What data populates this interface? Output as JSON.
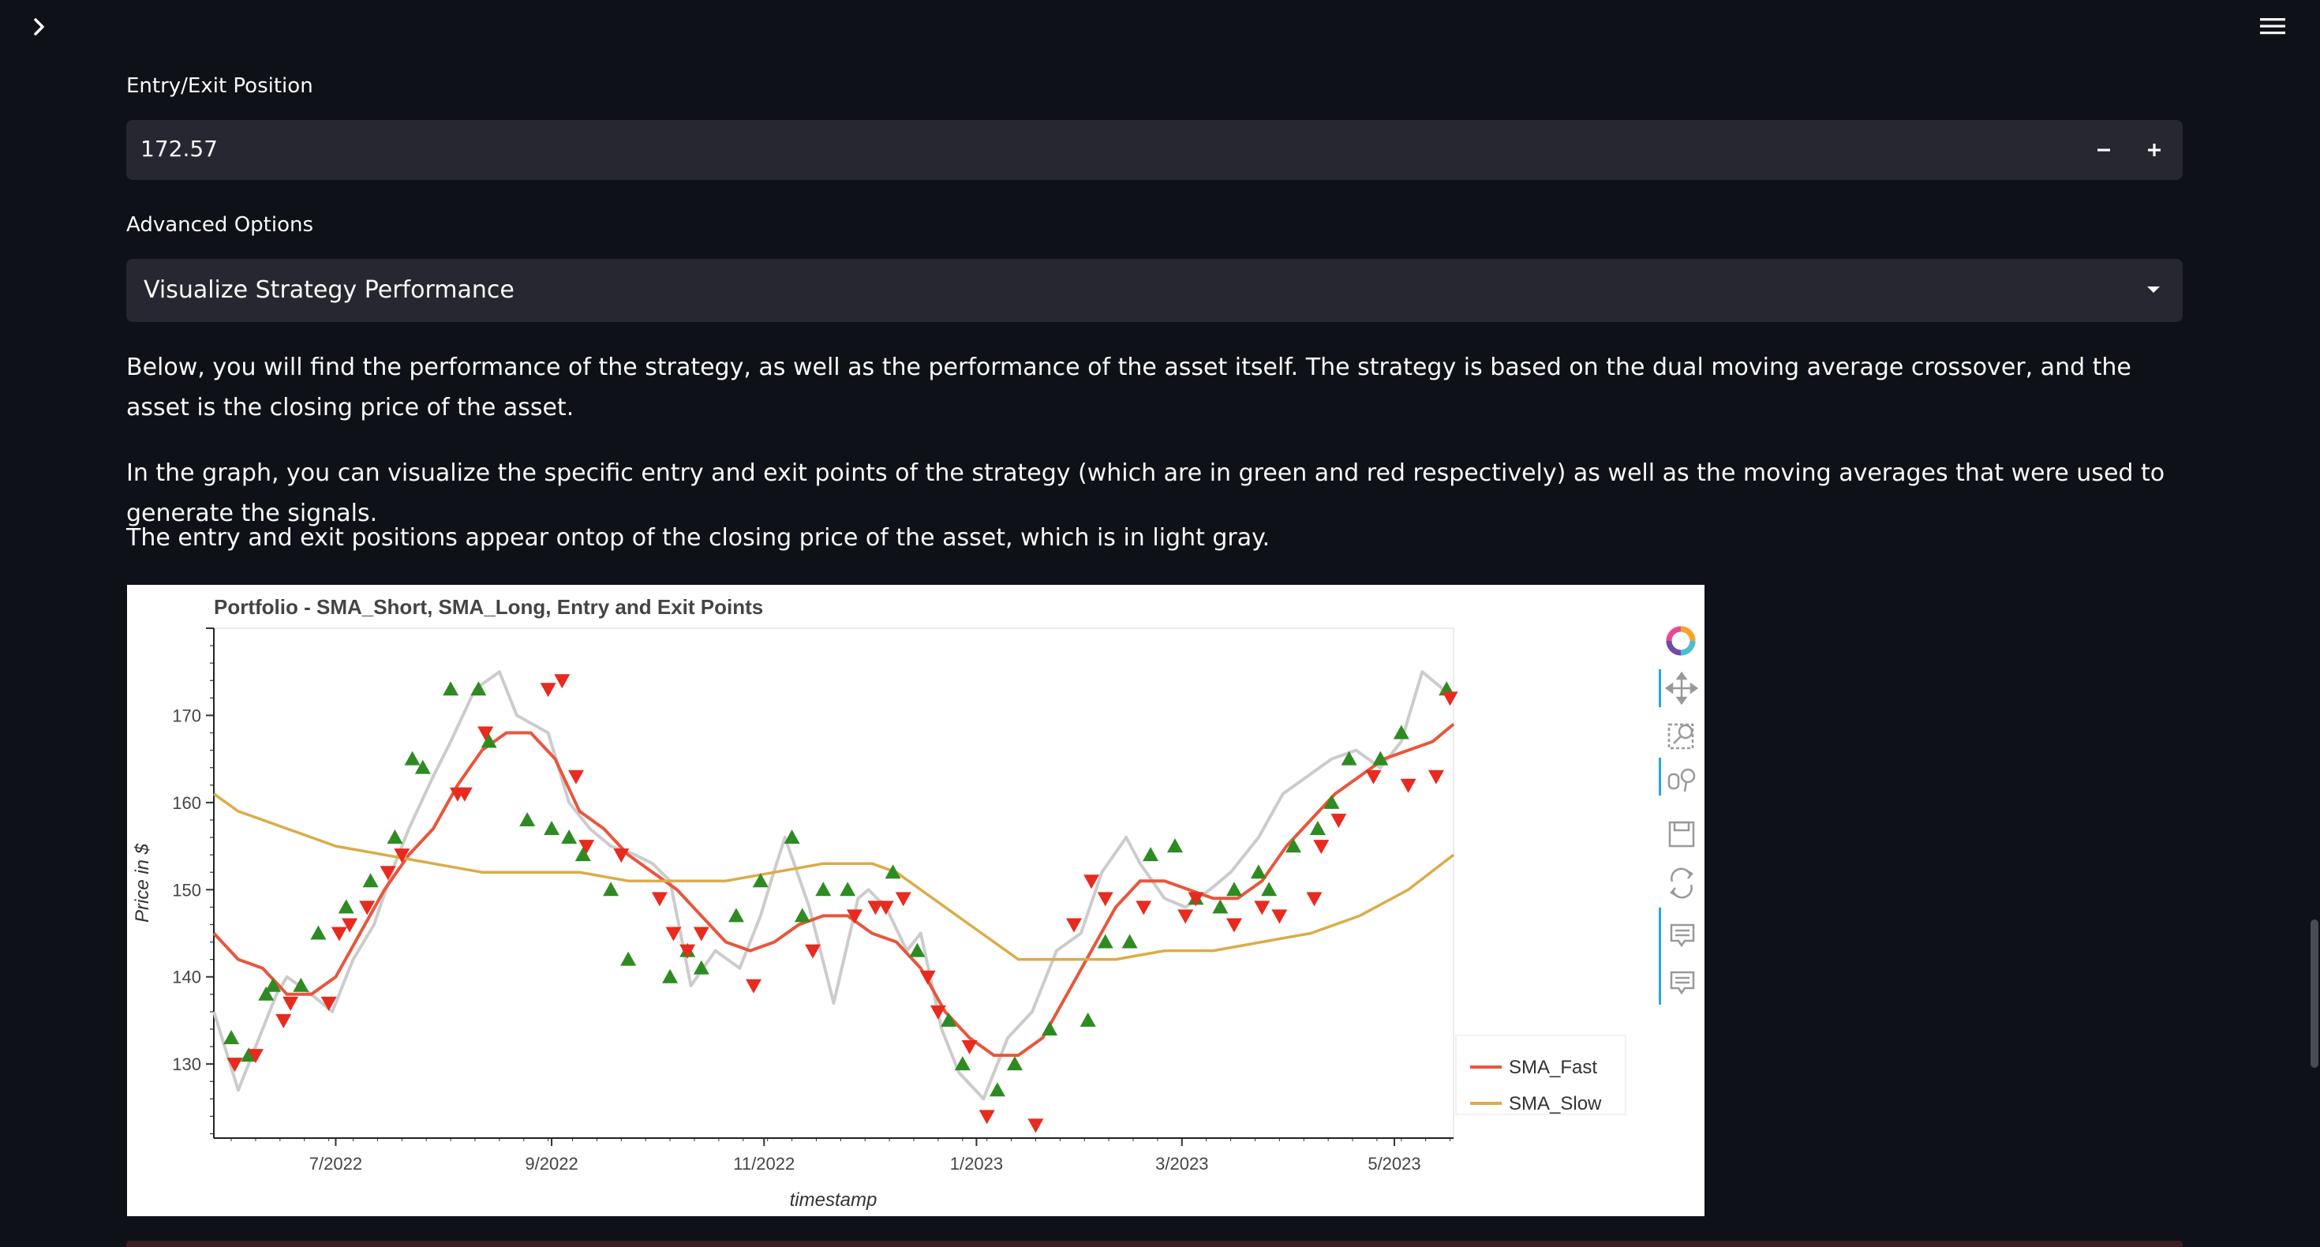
{
  "entry_exit": {
    "label": "Entry/Exit Position",
    "value": "172.57",
    "decrement_icon": "minus-icon",
    "increment_icon": "plus-icon"
  },
  "advanced": {
    "label": "Advanced Options",
    "selected": "Visualize Strategy Performance"
  },
  "paragraphs": {
    "p1": "Below, you will find the performance of the strategy, as well as the performance of the asset itself. The strategy is based on the dual moving average crossover, and the asset is the closing price of the asset.",
    "p2": "In the graph, you can visualize the specific entry and exit points of the strategy (which are in green and red respectively) as well as the moving averages that were used to generate the signals.",
    "p3": "The entry and exit positions appear ontop of the closing price of the asset, which is in light gray."
  },
  "toolbar_icons": [
    "bokeh-logo-icon",
    "pan-icon",
    "box-zoom-icon",
    "wheel-zoom-icon",
    "save-icon",
    "reset-icon",
    "hover-icon",
    "hover-icon-2"
  ],
  "chart_data": {
    "type": "line",
    "title": "Portfolio - SMA_Short, SMA_Long, Entry and Exit Points",
    "xlabel": "timestamp",
    "ylabel": "Price in $",
    "x_ticks": [
      "7/2022",
      "9/2022",
      "11/2022",
      "1/2023",
      "3/2023",
      "5/2023"
    ],
    "x_range": [
      "2022-05-27",
      "2023-05-18"
    ],
    "ylim": [
      121.5,
      180
    ],
    "y_ticks": [
      130,
      140,
      150,
      160,
      170
    ],
    "legend_position": "bottom-right",
    "colors": {
      "close": "#cccccc",
      "fast": "#e8563b",
      "slow": "#dcab48",
      "entry": "#2e8b22",
      "exit": "#e82a1f"
    },
    "series": [
      {
        "name": "Close",
        "x": [
          "2022-05-27",
          "2022-06-03",
          "2022-06-07",
          "2022-06-14",
          "2022-06-17",
          "2022-06-24",
          "2022-06-30",
          "2022-07-06",
          "2022-07-12",
          "2022-07-18",
          "2022-07-22",
          "2022-07-29",
          "2022-08-03",
          "2022-08-10",
          "2022-08-17",
          "2022-08-22",
          "2022-08-31",
          "2022-09-06",
          "2022-09-12",
          "2022-09-18",
          "2022-09-25",
          "2022-09-30",
          "2022-10-05",
          "2022-10-11",
          "2022-10-18",
          "2022-10-25",
          "2022-10-31",
          "2022-11-03",
          "2022-11-07",
          "2022-11-14",
          "2022-11-21",
          "2022-11-28",
          "2022-12-01",
          "2022-12-06",
          "2022-12-12",
          "2022-12-16",
          "2022-12-22",
          "2022-12-27",
          "2023-01-03",
          "2023-01-10",
          "2023-01-17",
          "2023-01-24",
          "2023-01-31",
          "2023-02-06",
          "2023-02-13",
          "2023-02-17",
          "2023-02-24",
          "2023-03-02",
          "2023-03-09",
          "2023-03-15",
          "2023-03-23",
          "2023-03-30",
          "2023-04-06",
          "2023-04-13",
          "2023-04-20",
          "2023-04-27",
          "2023-05-03",
          "2023-05-09",
          "2023-05-15"
        ],
        "values": [
          136,
          127,
          131,
          138,
          140,
          138,
          136,
          142,
          146,
          153,
          157,
          163,
          167,
          173,
          175,
          170,
          168,
          160,
          157,
          155,
          154,
          153,
          151,
          139,
          143,
          141,
          147,
          151,
          156,
          148,
          137,
          149,
          150,
          148,
          143,
          145,
          134,
          129,
          126,
          133,
          136,
          143,
          145,
          152,
          156,
          153,
          149,
          148,
          150,
          152,
          156,
          161,
          163,
          165,
          166,
          164,
          167,
          175,
          173
        ]
      },
      {
        "name": "SMA_Fast",
        "x": [
          "2022-05-27",
          "2022-06-03",
          "2022-06-10",
          "2022-06-17",
          "2022-06-24",
          "2022-07-01",
          "2022-07-08",
          "2022-07-15",
          "2022-07-22",
          "2022-07-29",
          "2022-08-05",
          "2022-08-12",
          "2022-08-19",
          "2022-08-26",
          "2022-09-02",
          "2022-09-09",
          "2022-09-16",
          "2022-09-23",
          "2022-09-30",
          "2022-10-07",
          "2022-10-14",
          "2022-10-21",
          "2022-10-28",
          "2022-11-04",
          "2022-11-11",
          "2022-11-18",
          "2022-11-25",
          "2022-12-02",
          "2022-12-09",
          "2022-12-16",
          "2022-12-23",
          "2022-12-30",
          "2023-01-06",
          "2023-01-13",
          "2023-01-20",
          "2023-01-27",
          "2023-02-03",
          "2023-02-10",
          "2023-02-17",
          "2023-02-24",
          "2023-03-03",
          "2023-03-10",
          "2023-03-17",
          "2023-03-24",
          "2023-03-31",
          "2023-04-07",
          "2023-04-14",
          "2023-04-21",
          "2023-04-28",
          "2023-05-05",
          "2023-05-12",
          "2023-05-18"
        ],
        "values": [
          145,
          142,
          141,
          138,
          138,
          140,
          145,
          150,
          154,
          157,
          162,
          166,
          168,
          168,
          165,
          159,
          157,
          154,
          152,
          150,
          147,
          144,
          143,
          144,
          146,
          147,
          147,
          145,
          144,
          141,
          136,
          133,
          131,
          131,
          133,
          138,
          143,
          148,
          151,
          151,
          150,
          149,
          149,
          151,
          155,
          158,
          161,
          163,
          165,
          166,
          167,
          169
        ]
      },
      {
        "name": "SMA_Slow",
        "x": [
          "2022-05-27",
          "2022-06-03",
          "2022-06-10",
          "2022-06-17",
          "2022-06-24",
          "2022-07-01",
          "2022-07-15",
          "2022-07-29",
          "2022-08-12",
          "2022-08-26",
          "2022-09-09",
          "2022-09-23",
          "2022-10-07",
          "2022-10-21",
          "2022-11-04",
          "2022-11-18",
          "2022-12-02",
          "2022-12-09",
          "2022-12-16",
          "2022-12-23",
          "2022-12-30",
          "2023-01-06",
          "2023-01-13",
          "2023-01-27",
          "2023-02-10",
          "2023-02-24",
          "2023-03-10",
          "2023-03-24",
          "2023-04-07",
          "2023-04-21",
          "2023-05-05",
          "2023-05-18"
        ],
        "values": [
          161,
          159,
          158,
          157,
          156,
          155,
          154,
          153,
          152,
          152,
          152,
          151,
          151,
          151,
          152,
          153,
          153,
          152,
          150,
          148,
          146,
          144,
          142,
          142,
          142,
          143,
          143,
          144,
          145,
          147,
          150,
          154
        ]
      }
    ],
    "entries": {
      "x": [
        "2022-06-01",
        "2022-06-06",
        "2022-06-11",
        "2022-06-13",
        "2022-06-21",
        "2022-06-26",
        "2022-07-04",
        "2022-07-11",
        "2022-07-18",
        "2022-07-23",
        "2022-07-26",
        "2022-08-03",
        "2022-08-11",
        "2022-08-14",
        "2022-08-25",
        "2022-09-01",
        "2022-09-06",
        "2022-09-10",
        "2022-09-18",
        "2022-09-23",
        "2022-10-05",
        "2022-10-10",
        "2022-10-14",
        "2022-10-24",
        "2022-10-31",
        "2022-11-09",
        "2022-11-12",
        "2022-11-18",
        "2022-11-25",
        "2022-12-08",
        "2022-12-15",
        "2022-12-24",
        "2022-12-28",
        "2023-01-07",
        "2023-01-12",
        "2023-01-22",
        "2023-02-02",
        "2023-02-07",
        "2023-02-14",
        "2023-02-20",
        "2023-02-27",
        "2023-03-05",
        "2023-03-12",
        "2023-03-16",
        "2023-03-23",
        "2023-03-26",
        "2023-04-02",
        "2023-04-09",
        "2023-04-13",
        "2023-04-18",
        "2023-04-27",
        "2023-05-03",
        "2023-05-16"
      ],
      "values": [
        133,
        131,
        138,
        139,
        139,
        145,
        148,
        151,
        156,
        165,
        164,
        173,
        173,
        167,
        158,
        157,
        156,
        154,
        150,
        142,
        140,
        143,
        141,
        147,
        151,
        156,
        147,
        150,
        150,
        152,
        143,
        135,
        130,
        127,
        130,
        134,
        135,
        144,
        144,
        154,
        155,
        149,
        148,
        150,
        152,
        150,
        155,
        157,
        160,
        165,
        165,
        168,
        173
      ]
    },
    "exits": {
      "x": [
        "2022-06-02",
        "2022-06-08",
        "2022-06-16",
        "2022-06-18",
        "2022-06-29",
        "2022-07-02",
        "2022-07-05",
        "2022-07-10",
        "2022-07-16",
        "2022-07-20",
        "2022-08-05",
        "2022-08-07",
        "2022-08-13",
        "2022-08-31",
        "2022-09-04",
        "2022-09-08",
        "2022-09-11",
        "2022-09-21",
        "2022-10-02",
        "2022-10-06",
        "2022-10-10",
        "2022-10-14",
        "2022-10-29",
        "2022-11-15",
        "2022-11-27",
        "2022-12-03",
        "2022-12-06",
        "2022-12-11",
        "2022-12-18",
        "2022-12-21",
        "2022-12-30",
        "2023-01-04",
        "2023-01-18",
        "2023-01-29",
        "2023-02-03",
        "2023-02-07",
        "2023-02-18",
        "2023-03-02",
        "2023-03-05",
        "2023-03-16",
        "2023-03-24",
        "2023-03-29",
        "2023-04-08",
        "2023-04-10",
        "2023-04-15",
        "2023-04-25",
        "2023-05-05",
        "2023-05-13",
        "2023-05-17"
      ],
      "values": [
        130,
        131,
        135,
        137,
        137,
        145,
        146,
        148,
        152,
        154,
        161,
        161,
        168,
        173,
        174,
        163,
        155,
        154,
        149,
        145,
        143,
        145,
        139,
        143,
        147,
        148,
        148,
        149,
        140,
        136,
        132,
        124,
        123,
        146,
        151,
        149,
        148,
        147,
        149,
        146,
        148,
        147,
        149,
        155,
        158,
        163,
        162,
        163,
        172
      ]
    }
  },
  "legend": {
    "fast": "SMA_Fast",
    "slow": "SMA_Slow"
  }
}
